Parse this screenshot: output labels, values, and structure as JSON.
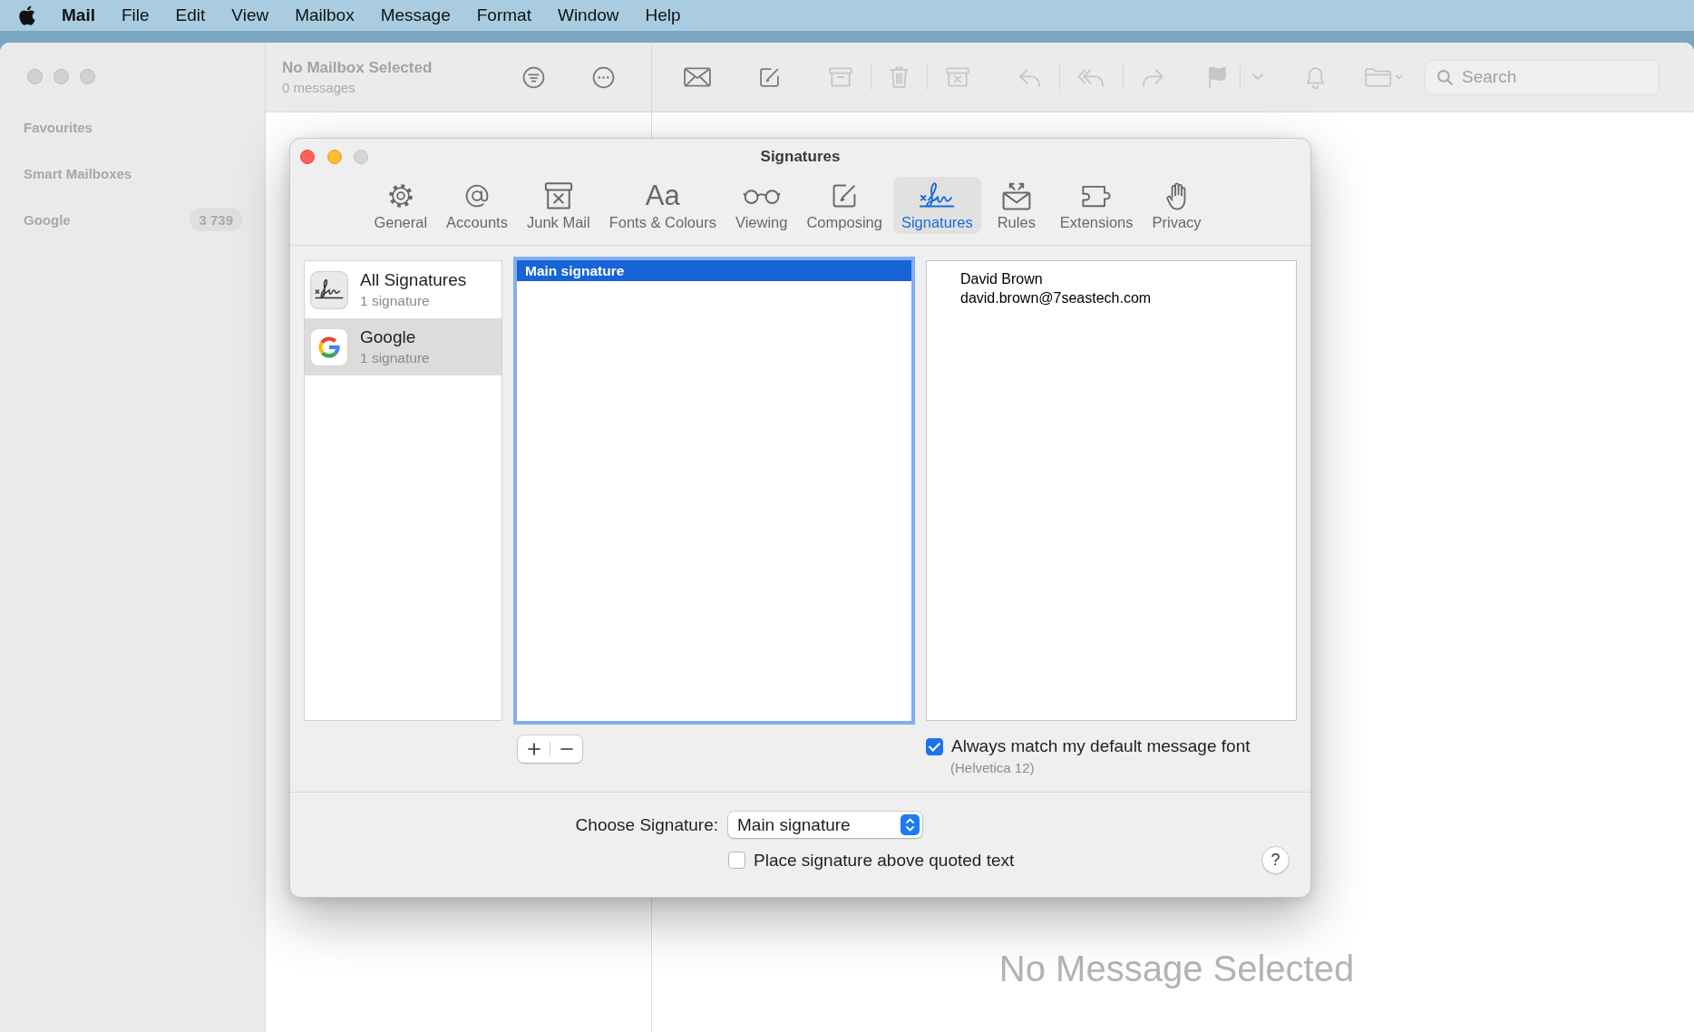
{
  "menu_bar": {
    "app_name": "Mail",
    "items": [
      "File",
      "Edit",
      "View",
      "Mailbox",
      "Message",
      "Format",
      "Window",
      "Help"
    ]
  },
  "sidebar": {
    "sections": [
      {
        "label": "Favourites"
      },
      {
        "label": "Smart Mailboxes"
      },
      {
        "label": "Google",
        "badge": "3 739"
      }
    ]
  },
  "message_list": {
    "title": "No Mailbox Selected",
    "subtitle": "0 messages",
    "buttons": [
      {
        "kind": "filter",
        "disabled": false
      },
      {
        "kind": "more",
        "disabled": false
      }
    ]
  },
  "toolbar": {
    "groups": [
      [
        {
          "kind": "envelope",
          "disabled": false
        }
      ],
      [
        {
          "kind": "compose",
          "disabled": false
        }
      ],
      [
        {
          "kind": "archive",
          "disabled": true
        },
        {
          "kind": "trash",
          "disabled": true
        },
        {
          "kind": "junk",
          "disabled": true
        }
      ],
      [
        {
          "kind": "reply",
          "disabled": true
        },
        {
          "kind": "reply-all",
          "disabled": true
        },
        {
          "kind": "forward",
          "disabled": true
        }
      ],
      [
        {
          "kind": "flag",
          "disabled": true
        },
        {
          "kind": "chevron",
          "disabled": true
        }
      ],
      [
        {
          "kind": "bell",
          "disabled": true
        }
      ],
      [
        {
          "kind": "folder-menu",
          "disabled": true
        }
      ]
    ],
    "search": {
      "placeholder": "Search"
    }
  },
  "message_view": {
    "empty_text": "No Message Selected"
  },
  "preferences": {
    "title": "Signatures",
    "tabs": [
      {
        "kind": "general",
        "label": "General",
        "selected": false
      },
      {
        "kind": "accounts",
        "label": "Accounts",
        "selected": false
      },
      {
        "kind": "junk",
        "label": "Junk Mail",
        "selected": false
      },
      {
        "kind": "fonts",
        "glyph": "Aa",
        "label": "Fonts & Colours",
        "selected": false
      },
      {
        "kind": "viewing",
        "label": "Viewing",
        "selected": false
      },
      {
        "kind": "composing",
        "label": "Composing",
        "selected": false
      },
      {
        "kind": "signatures",
        "label": "Signatures",
        "selected": true
      },
      {
        "kind": "rules",
        "label": "Rules",
        "selected": false
      },
      {
        "kind": "extensions",
        "label": "Extensions",
        "selected": false
      },
      {
        "kind": "privacy",
        "label": "Privacy",
        "selected": false
      }
    ],
    "accounts": [
      {
        "kind": "all",
        "name": "All Signatures",
        "detail": "1 signature",
        "selected": false
      },
      {
        "kind": "google",
        "name": "Google",
        "detail": "1 signature",
        "selected": true
      }
    ],
    "signature_list": {
      "focused": true,
      "items": [
        {
          "name": "Main signature",
          "selected": true
        }
      ]
    },
    "preview": {
      "lines": [
        "David Brown",
        "david.brown@7seastech.com"
      ]
    },
    "match_font": {
      "label": "Always match my default message font",
      "checked": true,
      "note": "(Helvetica 12)"
    },
    "choose_signature": {
      "label": "Choose Signature:",
      "value": "Main signature"
    },
    "place_above": {
      "label": "Place signature above quoted text",
      "checked": false
    },
    "help": "?"
  }
}
